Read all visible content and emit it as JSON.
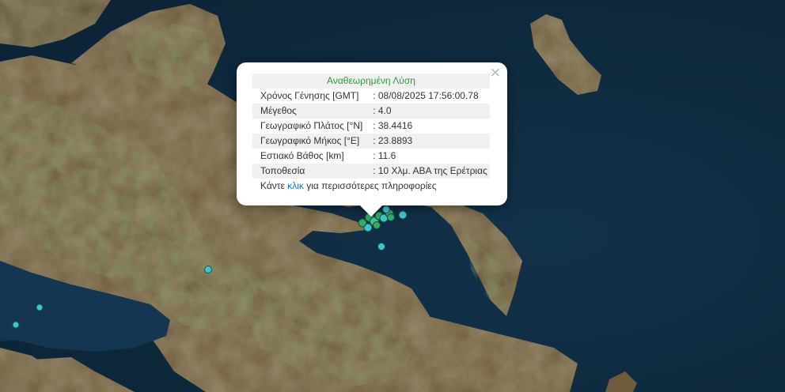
{
  "popup": {
    "title": "Αναθεωρημένη Λύση",
    "close_label": "×",
    "rows": [
      {
        "label": "Χρόνος Γένησης [GMT]",
        "value": ": 08/08/2025 17:56:00.78"
      },
      {
        "label": "Μέγεθος",
        "value": ": 4.0"
      },
      {
        "label": "Γεωγραφικό Πλάτος [°N]",
        "value": ": 38.4416"
      },
      {
        "label": "Γεωγραφικό Μήκος [°E]",
        "value": ": 23.8893"
      },
      {
        "label": "Εστιακό Βάθος [km]",
        "value": ": 11.6"
      },
      {
        "label": "Τοποθεσία",
        "value": ": 10 Χλμ. ΑΒΑ της Ερέτριας"
      }
    ],
    "more_prefix": "Κάντε ",
    "more_link": "κλικ",
    "more_suffix": " για περισσότερες πληροφορίες"
  },
  "colors": {
    "sea": "#0f2a3f",
    "land": "#6b5a3a",
    "vegetation": "#3f5a2a",
    "marker_fill": "#3fc7c7",
    "marker_cluster": "#2fae6a",
    "title_green": "#2a9a3a",
    "link_blue": "#1a70c8"
  }
}
